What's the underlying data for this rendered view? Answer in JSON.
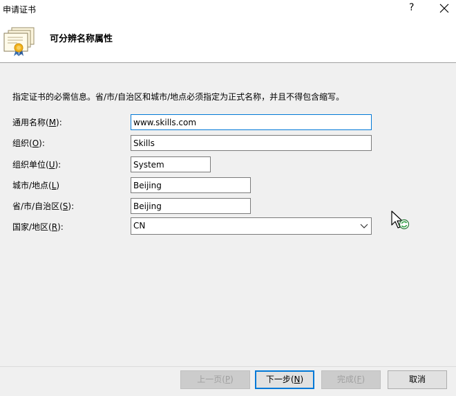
{
  "window": {
    "title": "申请证书",
    "help_label": "?"
  },
  "header": {
    "heading": "可分辨名称属性",
    "icon": "certificate-icon"
  },
  "form": {
    "instruction": "指定证书的必需信息。省/市/自治区和城市/地点必须指定为正式名称，并且不得包含缩写。",
    "fields": [
      {
        "label": "通用名称(",
        "accel": "M",
        "suffix": "):",
        "value": "www.skills.com"
      },
      {
        "label": "组织(",
        "accel": "O",
        "suffix": "):",
        "value": "Skills"
      },
      {
        "label": "组织单位(",
        "accel": "U",
        "suffix": "):",
        "value": "System"
      },
      {
        "label": "城市/地点(",
        "accel": "L",
        "suffix": ")",
        "value": "Beijing"
      },
      {
        "label": "省/市/自治区(",
        "accel": "S",
        "suffix": "):",
        "value": "Beijing"
      },
      {
        "label": "国家/地区(",
        "accel": "R",
        "suffix": "):",
        "value": "CN"
      }
    ]
  },
  "buttons": {
    "prev": {
      "label": "上一页(",
      "accel": "P",
      "suffix": ")"
    },
    "next": {
      "label": "下一步(",
      "accel": "N",
      "suffix": ")"
    },
    "finish": {
      "label": "完成(",
      "accel": "F",
      "suffix": ")"
    },
    "cancel": {
      "label": "取消"
    }
  },
  "colors": {
    "focus_border": "#0078d7",
    "disabled_text": "#a0a0a0"
  }
}
